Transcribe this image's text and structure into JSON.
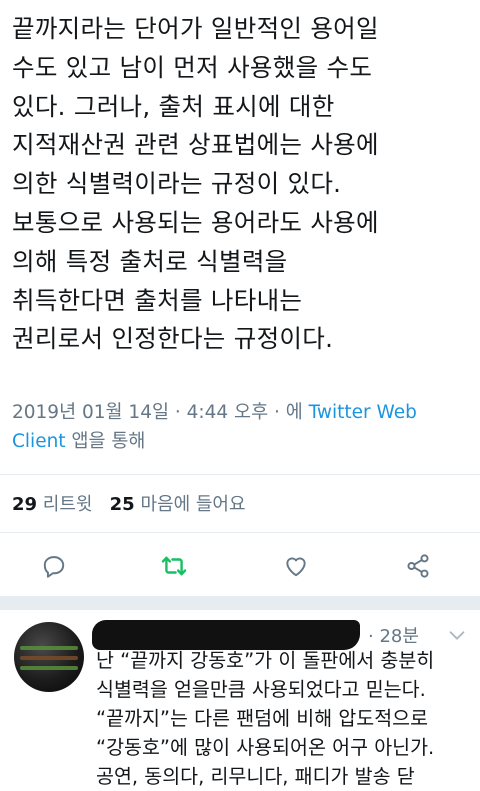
{
  "tweet": {
    "text": "끝까지라는 단어가 일반적인 용어일\n수도 있고 남이 먼저 사용했을 수도\n있다. 그러나, 출처 표시에 대한\n지적재산권 관련 상표법에는 사용에\n의한 식별력이라는 규정이 있다.\n보통으로 사용되는 용어라도 사용에\n의해 특정 출처로 식별력을\n취득한다면 출처를 나타내는\n권리로서 인정한다는 규정이다.",
    "date": "2019년 01월 14일 · 4:44 오후 · 에 ",
    "client": "Twitter Web Client",
    "client_suffix": " 앱을 통해",
    "retweets_count": "29",
    "retweets_label": "리트윗",
    "likes_count": "25",
    "likes_label": "마음에 들어요"
  },
  "actions": {
    "reply_icon": "reply-icon",
    "retweet_icon": "retweet-icon",
    "like_icon": "heart-icon",
    "share_icon": "share-icon",
    "retweet_color": "#17bf63"
  },
  "reply": {
    "time": "· 28분",
    "text": "난 “끝까지 강동호”가 이 돌판에서 충분히\n식별력을 얻을만큼 사용되었다고 믿는다.\n“끝까지”는 다른 팬덤에 비해 압도적으로\n“강동호”에 많이 사용되어온 어구 아닌가.\n공연, 동의다, 리무니다, 패디가 발송 닫"
  }
}
